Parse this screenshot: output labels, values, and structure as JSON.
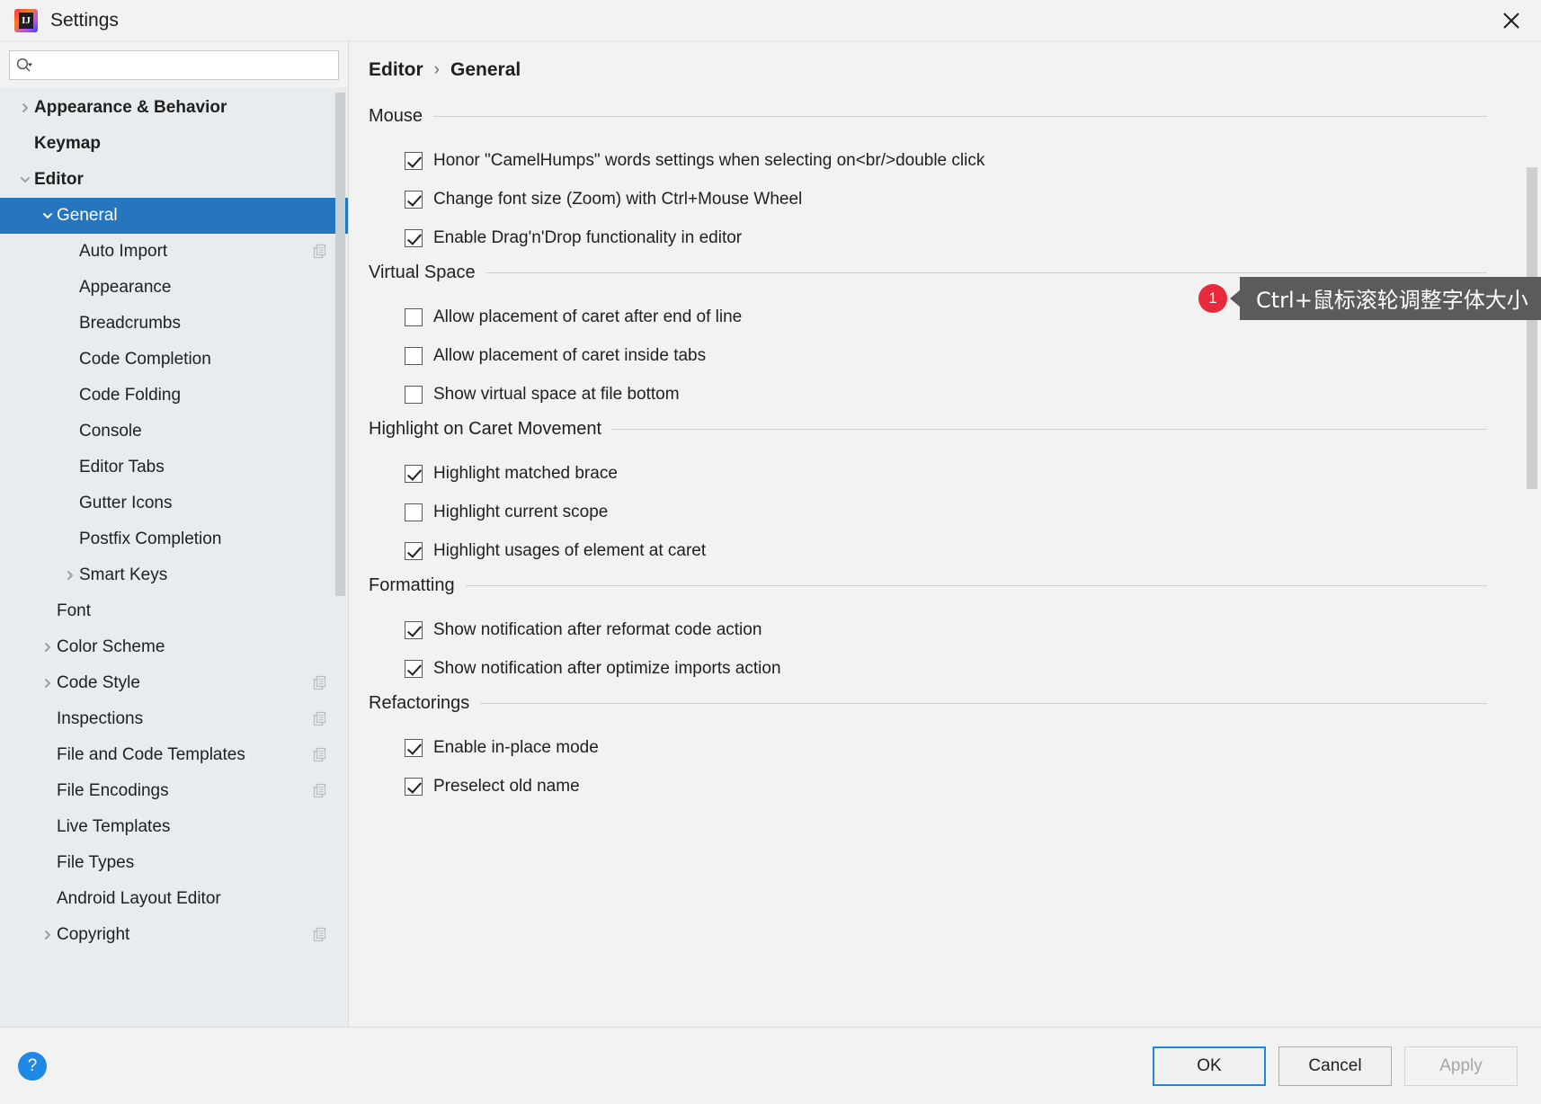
{
  "window": {
    "title": "Settings",
    "app_icon": "intellij-idea-icon",
    "close_label": "×"
  },
  "search": {
    "placeholder": "",
    "value": "",
    "icon": "search-icon"
  },
  "sidebar": {
    "items": [
      {
        "label": "Appearance & Behavior",
        "indent": 0,
        "arrow": "right",
        "bold": true,
        "selected": false,
        "copyable": false
      },
      {
        "label": "Keymap",
        "indent": 0,
        "arrow": "none",
        "bold": true,
        "selected": false,
        "copyable": false
      },
      {
        "label": "Editor",
        "indent": 0,
        "arrow": "down",
        "bold": true,
        "selected": false,
        "copyable": false
      },
      {
        "label": "General",
        "indent": 1,
        "arrow": "down",
        "bold": false,
        "selected": true,
        "copyable": false
      },
      {
        "label": "Auto Import",
        "indent": 2,
        "arrow": "none",
        "bold": false,
        "selected": false,
        "copyable": true
      },
      {
        "label": "Appearance",
        "indent": 2,
        "arrow": "none",
        "bold": false,
        "selected": false,
        "copyable": false
      },
      {
        "label": "Breadcrumbs",
        "indent": 2,
        "arrow": "none",
        "bold": false,
        "selected": false,
        "copyable": false
      },
      {
        "label": "Code Completion",
        "indent": 2,
        "arrow": "none",
        "bold": false,
        "selected": false,
        "copyable": false
      },
      {
        "label": "Code Folding",
        "indent": 2,
        "arrow": "none",
        "bold": false,
        "selected": false,
        "copyable": false
      },
      {
        "label": "Console",
        "indent": 2,
        "arrow": "none",
        "bold": false,
        "selected": false,
        "copyable": false
      },
      {
        "label": "Editor Tabs",
        "indent": 2,
        "arrow": "none",
        "bold": false,
        "selected": false,
        "copyable": false
      },
      {
        "label": "Gutter Icons",
        "indent": 2,
        "arrow": "none",
        "bold": false,
        "selected": false,
        "copyable": false
      },
      {
        "label": "Postfix Completion",
        "indent": 2,
        "arrow": "none",
        "bold": false,
        "selected": false,
        "copyable": false
      },
      {
        "label": "Smart Keys",
        "indent": 2,
        "arrow": "right",
        "bold": false,
        "selected": false,
        "copyable": false
      },
      {
        "label": "Font",
        "indent": 1,
        "arrow": "none",
        "bold": false,
        "selected": false,
        "copyable": false
      },
      {
        "label": "Color Scheme",
        "indent": 1,
        "arrow": "right",
        "bold": false,
        "selected": false,
        "copyable": false
      },
      {
        "label": "Code Style",
        "indent": 1,
        "arrow": "right",
        "bold": false,
        "selected": false,
        "copyable": true
      },
      {
        "label": "Inspections",
        "indent": 1,
        "arrow": "none",
        "bold": false,
        "selected": false,
        "copyable": true
      },
      {
        "label": "File and Code Templates",
        "indent": 1,
        "arrow": "none",
        "bold": false,
        "selected": false,
        "copyable": true
      },
      {
        "label": "File Encodings",
        "indent": 1,
        "arrow": "none",
        "bold": false,
        "selected": false,
        "copyable": true
      },
      {
        "label": "Live Templates",
        "indent": 1,
        "arrow": "none",
        "bold": false,
        "selected": false,
        "copyable": false
      },
      {
        "label": "File Types",
        "indent": 1,
        "arrow": "none",
        "bold": false,
        "selected": false,
        "copyable": false
      },
      {
        "label": "Android Layout Editor",
        "indent": 1,
        "arrow": "none",
        "bold": false,
        "selected": false,
        "copyable": false
      },
      {
        "label": "Copyright",
        "indent": 1,
        "arrow": "right",
        "bold": false,
        "selected": false,
        "copyable": true
      }
    ]
  },
  "breadcrumb": {
    "root": "Editor",
    "separator": "›",
    "leaf": "General"
  },
  "sections": [
    {
      "title": "Mouse",
      "options": [
        {
          "label": "Honor \"CamelHumps\" words settings when selecting on<br/>double click",
          "checked": true
        },
        {
          "label": "Change font size (Zoom) with Ctrl+Mouse Wheel",
          "checked": true
        },
        {
          "label": "Enable Drag'n'Drop functionality in editor",
          "checked": true
        }
      ]
    },
    {
      "title": "Virtual Space",
      "options": [
        {
          "label": "Allow placement of caret after end of line",
          "checked": false
        },
        {
          "label": "Allow placement of caret inside tabs",
          "checked": false
        },
        {
          "label": "Show virtual space at file bottom",
          "checked": false
        }
      ]
    },
    {
      "title": "Highlight on Caret Movement",
      "options": [
        {
          "label": "Highlight matched brace",
          "checked": true
        },
        {
          "label": "Highlight current scope",
          "checked": false
        },
        {
          "label": "Highlight usages of element at caret",
          "checked": true
        }
      ]
    },
    {
      "title": "Formatting",
      "options": [
        {
          "label": "Show notification after reformat code action",
          "checked": true
        },
        {
          "label": "Show notification after optimize imports action",
          "checked": true
        }
      ]
    },
    {
      "title": "Refactorings",
      "options": [
        {
          "label": "Enable in-place mode",
          "checked": true
        },
        {
          "label": "Preselect old name",
          "checked": true
        }
      ]
    }
  ],
  "callout": {
    "badge": "1",
    "text": "Ctrl+鼠标滚轮调整字体大小"
  },
  "footer": {
    "help": "?",
    "ok": "OK",
    "cancel": "Cancel",
    "apply": "Apply"
  },
  "colors": {
    "selection_blue": "#2675bf",
    "accent_blue": "#1f87e4",
    "badge_red": "#e8293b",
    "tooltip_bg": "#5b5b5b",
    "sidebar_bg": "#e8ecef",
    "panel_bg": "#f2f2f2"
  }
}
